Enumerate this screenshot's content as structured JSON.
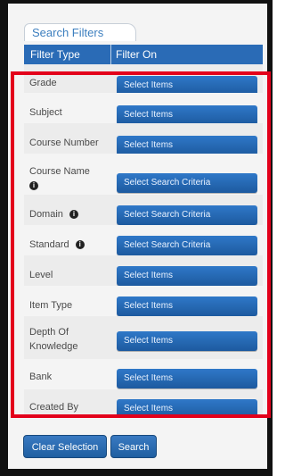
{
  "tab": {
    "label": "Search Filters"
  },
  "table": {
    "headers": {
      "filter_type": "Filter Type",
      "filter_on": "Filter On"
    },
    "rows": [
      {
        "label": "Grade",
        "button": "Select Items",
        "info": ""
      },
      {
        "label": "Subject",
        "button": "Select Items",
        "info": ""
      },
      {
        "label": "Course Number",
        "button": "Select Items",
        "info": ""
      },
      {
        "label": "Course Name",
        "button": "Select Search Criteria",
        "info": "i"
      },
      {
        "label": "Domain",
        "button": "Select Search Criteria",
        "info": "i"
      },
      {
        "label": "Standard",
        "button": "Select Search Criteria",
        "info": "i"
      },
      {
        "label": "Level",
        "button": "Select Items",
        "info": ""
      },
      {
        "label": "Item Type",
        "button": "Select Items",
        "info": ""
      },
      {
        "label": "Depth Of Knowledge",
        "button": "Select Items",
        "info": ""
      },
      {
        "label": "Bank",
        "button": "Select Items",
        "info": ""
      },
      {
        "label": "Created By",
        "button": "Select Items",
        "info": ""
      }
    ]
  },
  "footer": {
    "clear": "Clear Selection",
    "search": "Search"
  },
  "colors": {
    "accent": "#2a6bb6",
    "highlight": "#e3001b"
  }
}
